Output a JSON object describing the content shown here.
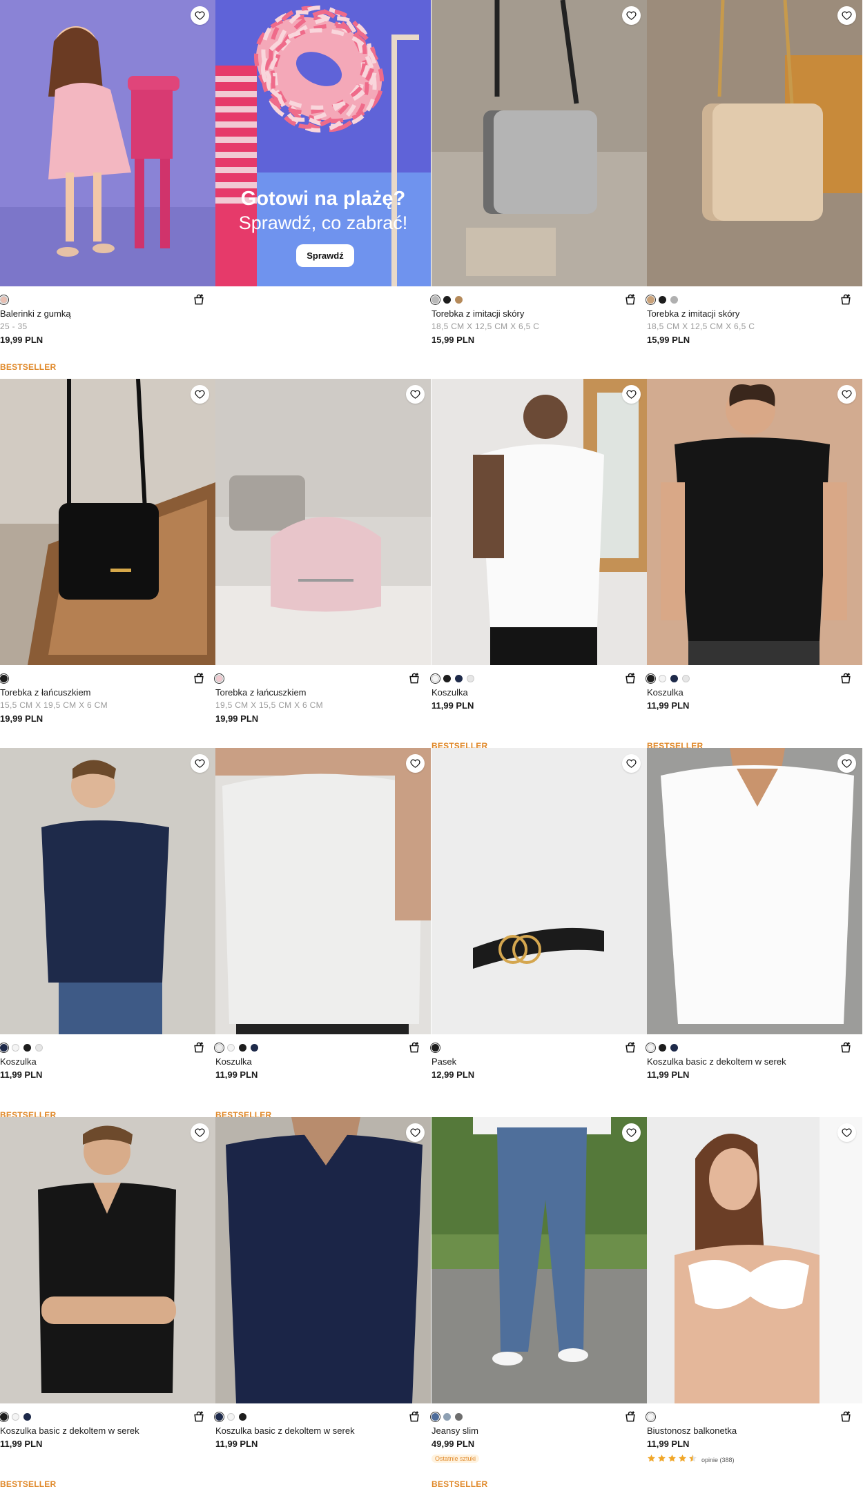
{
  "promo": {
    "title": "Gotowi na plażę?",
    "subtitle": "Sprawdź, co zabrać!",
    "button_label": "Sprawdź"
  },
  "products": [
    {
      "name": "Balerinki z gumką",
      "size": "25 - 35",
      "price": "19,99 PLN",
      "badge": "BESTSELLER",
      "swatches": [
        "#e8bfb2"
      ],
      "image": "girl-pink-dress"
    },
    {
      "promo": true
    },
    {
      "name": "Torebka z imitacji skóry",
      "size": "18,5 CM X 12,5 CM X 6,5 C",
      "price": "15,99 PLN",
      "badge": "",
      "swatches": [
        "#b9b9b9",
        "#1d1d1d",
        "#b58a5a"
      ],
      "image": "grey-handbag"
    },
    {
      "name": "Torebka z imitacji skóry",
      "size": "18,5 CM X 12,5 CM X 6,5 C",
      "price": "15,99 PLN",
      "badge": "",
      "swatches": [
        "#c9a27a",
        "#1d1d1d",
        "#b0b0b0"
      ],
      "image": "beige-handbag"
    },
    {
      "name": "Torebka z łańcuszkiem",
      "size": "15,5 CM X 19,5 CM X 6 CM",
      "price": "19,99 PLN",
      "badge": "",
      "swatches": [
        "#1d1d1d"
      ],
      "image": "black-chain-bag"
    },
    {
      "name": "Torebka z łańcuszkiem",
      "size": "19,5 CM X 15,5 CM X 6 CM",
      "price": "19,99 PLN",
      "badge": "",
      "swatches": [
        "#f0c9cf"
      ],
      "image": "pink-bag"
    },
    {
      "name": "Koszulka",
      "size": "",
      "price": "11,99 PLN",
      "badge": "BESTSELLER",
      "swatches": [
        "#f4f4f4",
        "#1d1d1d",
        "#1e2a4a",
        "#e6e6e6"
      ],
      "image": "man-white-tee"
    },
    {
      "name": "Koszulka",
      "size": "",
      "price": "11,99 PLN",
      "badge": "BESTSELLER",
      "swatches": [
        "#1d1d1d",
        "#f4f4f4",
        "#1e2a4a",
        "#e6e6e6"
      ],
      "image": "man-black-tee"
    },
    {
      "name": "Koszulka",
      "size": "",
      "price": "11,99 PLN",
      "badge": "BESTSELLER",
      "swatches": [
        "#1e2a4a",
        "#f4f4f4",
        "#1d1d1d",
        "#e6e6e6"
      ],
      "image": "man-navy-tee"
    },
    {
      "name": "Koszulka",
      "size": "",
      "price": "11,99 PLN",
      "badge": "BESTSELLER",
      "swatches": [
        "#eeeeee",
        "#f4f4f4",
        "#1d1d1d",
        "#1e2a4a"
      ],
      "image": "grey-tee"
    },
    {
      "name": "Pasek",
      "size": "",
      "price": "12,99 PLN",
      "badge": "",
      "swatches": [
        "#1d1d1d"
      ],
      "image": "belt"
    },
    {
      "name": "Koszulka basic z dekoltem w serek",
      "size": "",
      "price": "11,99 PLN",
      "badge": "",
      "swatches": [
        "#f4f4f4",
        "#1d1d1d",
        "#1e2a4a"
      ],
      "image": "man-white-vneck"
    },
    {
      "name": "Koszulka basic z dekoltem w serek",
      "size": "",
      "price": "11,99 PLN",
      "badge": "BESTSELLER",
      "swatches": [
        "#1d1d1d",
        "#f4f4f4",
        "#1e2a4a"
      ],
      "image": "man-black-vneck"
    },
    {
      "name": "Koszulka basic z dekoltem w serek",
      "size": "",
      "price": "11,99 PLN",
      "badge": "",
      "swatches": [
        "#1e2a4a",
        "#f4f4f4",
        "#1d1d1d"
      ],
      "image": "navy-vneck"
    },
    {
      "name": "Jeansy slim",
      "size": "",
      "price": "49,99 PLN",
      "badge": "BESTSELLER",
      "last": "Ostatnie sztuki",
      "swatches": [
        "#4d6c9a",
        "#8ea0b3",
        "#6e6e6e"
      ],
      "image": "jeans"
    },
    {
      "name": "Biustonosz balkonetka",
      "size": "",
      "price": "11,99 PLN",
      "badge": "",
      "rating": 4.5,
      "reviews": "opinie (388)",
      "swatches": [
        "#f5f5f5"
      ],
      "image": "white-bra"
    }
  ]
}
